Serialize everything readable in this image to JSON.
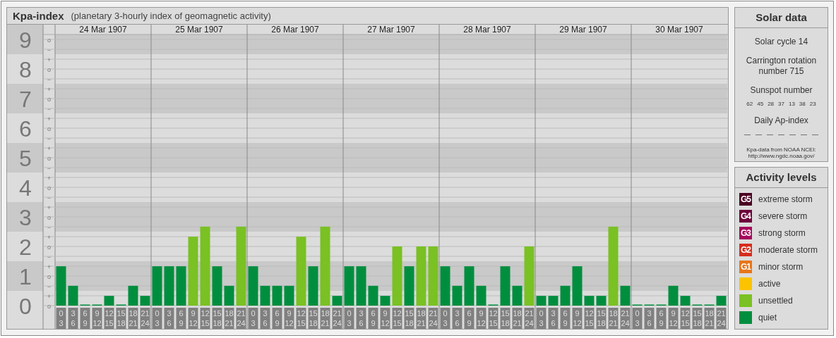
{
  "main_panel": {
    "title": "Kpa-index",
    "subtitle": "(planetary 3-hourly index of geomagnetic activity)",
    "days": [
      "24 Mar 1907",
      "25 Mar 1907",
      "26 Mar 1907",
      "27 Mar 1907",
      "28 Mar 1907",
      "29 Mar 1907",
      "30 Mar 1907"
    ],
    "sublevel_marks": [
      "o",
      "−",
      "+",
      "o",
      "−",
      "+",
      "o",
      "−",
      "+",
      "o",
      "−",
      "+",
      "o",
      "−",
      "+",
      "o",
      "−",
      "+",
      "o",
      "−",
      "+",
      "o",
      "−",
      "+",
      "o",
      "−",
      "+",
      "o"
    ],
    "chart_data": {
      "type": "bar",
      "grid": true,
      "ylim": [
        0,
        9.17
      ],
      "bands": [
        {
          "axis": "y",
          "from": 0.5,
          "to": 1.5
        },
        {
          "axis": "y",
          "from": 2.5,
          "to": 3.5
        },
        {
          "axis": "y",
          "from": 4.5,
          "to": 5.5
        },
        {
          "axis": "y",
          "from": 6.5,
          "to": 7.5
        },
        {
          "axis": "y",
          "from": 8.5,
          "to": 9.17
        }
      ],
      "yticks": [
        {
          "value": 0,
          "label": "0"
        },
        {
          "value": 1,
          "label": "1"
        },
        {
          "value": 2,
          "label": "2"
        },
        {
          "value": 3,
          "label": "3"
        },
        {
          "value": 4,
          "label": "4"
        },
        {
          "value": 5,
          "label": "5"
        },
        {
          "value": 6,
          "label": "6"
        },
        {
          "value": 7,
          "label": "7"
        },
        {
          "value": 8,
          "label": "8"
        },
        {
          "value": 9,
          "label": "9"
        }
      ],
      "categories": [
        "0 3",
        "3 6",
        "6 9",
        "9 12",
        "12 15",
        "15 18",
        "18 21",
        "21 24",
        "0 3",
        "3 6",
        "6 9",
        "9 12",
        "12 15",
        "15 18",
        "18 21",
        "21 24",
        "0 3",
        "3 6",
        "6 9",
        "9 12",
        "12 15",
        "15 18",
        "18 21",
        "21 24",
        "0 3",
        "3 6",
        "6 9",
        "9 12",
        "12 15",
        "15 18",
        "18 21",
        "21 24",
        "0 3",
        "3 6",
        "6 9",
        "9 12",
        "12 15",
        "15 18",
        "18 21",
        "21 24",
        "0 3",
        "3 6",
        "6 9",
        "9 12",
        "12 15",
        "15 18",
        "18 21",
        "21 24",
        "0 3",
        "3 6",
        "6 9",
        "9 12",
        "12 15",
        "15 18",
        "18 21",
        "21 24"
      ],
      "series": [
        {
          "color": "#008e3e",
          "values": [
            1.33,
            0.67,
            0,
            0,
            0.33,
            0,
            0.67,
            0.33,
            1.33,
            1.33,
            1.33,
            null,
            null,
            1.33,
            0.67,
            null,
            1.33,
            0.67,
            0.67,
            0.67,
            null,
            1.33,
            null,
            0.33,
            1.33,
            1.33,
            0.67,
            0.33,
            null,
            1.33,
            null,
            null,
            1.33,
            0.67,
            1.33,
            0.67,
            0,
            1.33,
            0.67,
            null,
            0.33,
            0.33,
            0.67,
            1.33,
            0.33,
            0.33,
            null,
            0.67,
            0,
            0,
            0,
            0.67,
            0.33,
            0,
            0,
            0.33
          ]
        },
        {
          "color": "#7ac123",
          "values": [
            null,
            null,
            null,
            null,
            null,
            null,
            null,
            null,
            null,
            null,
            null,
            2.33,
            2.67,
            null,
            null,
            2.67,
            null,
            null,
            null,
            null,
            2.33,
            null,
            2.67,
            null,
            null,
            null,
            null,
            null,
            2,
            null,
            2,
            2,
            null,
            null,
            null,
            null,
            null,
            null,
            null,
            2,
            null,
            null,
            null,
            null,
            null,
            null,
            2.67,
            null,
            null,
            null,
            null,
            null,
            null,
            null,
            null,
            null
          ]
        }
      ]
    }
  },
  "solar_data": {
    "title": "Solar data",
    "solar_cycle": "Solar cycle 14",
    "carrington": "Carrington rotation number 715",
    "sunspot_label": "Sunspot number",
    "sunspot_numbers": [
      "62",
      "45",
      "28",
      "37",
      "13",
      "38",
      "23"
    ],
    "ap_label": "Daily Ap-index",
    "ap_values": [
      "—",
      "—",
      "—",
      "—",
      "—",
      "—",
      "—"
    ],
    "source": "Kpa-data from NOAA NCEI:",
    "source_link": "http://www.ngdc.noaa.gov/"
  },
  "activity_levels": {
    "title": "Activity levels",
    "items": [
      {
        "badge": "G5",
        "label": "extreme storm",
        "color": "#4b0022"
      },
      {
        "badge": "G4",
        "label": "severe storm",
        "color": "#6d003b"
      },
      {
        "badge": "G3",
        "label": "strong storm",
        "color": "#a3085b"
      },
      {
        "badge": "G2",
        "label": "moderate storm",
        "color": "#d52e1e"
      },
      {
        "badge": "G1",
        "label": "minor storm",
        "color": "#e8761b"
      },
      {
        "label": "active",
        "color": "#fbc300"
      },
      {
        "label": "unsettled",
        "color": "#7ac123"
      },
      {
        "label": "quiet",
        "color": "#008e3e"
      }
    ]
  }
}
